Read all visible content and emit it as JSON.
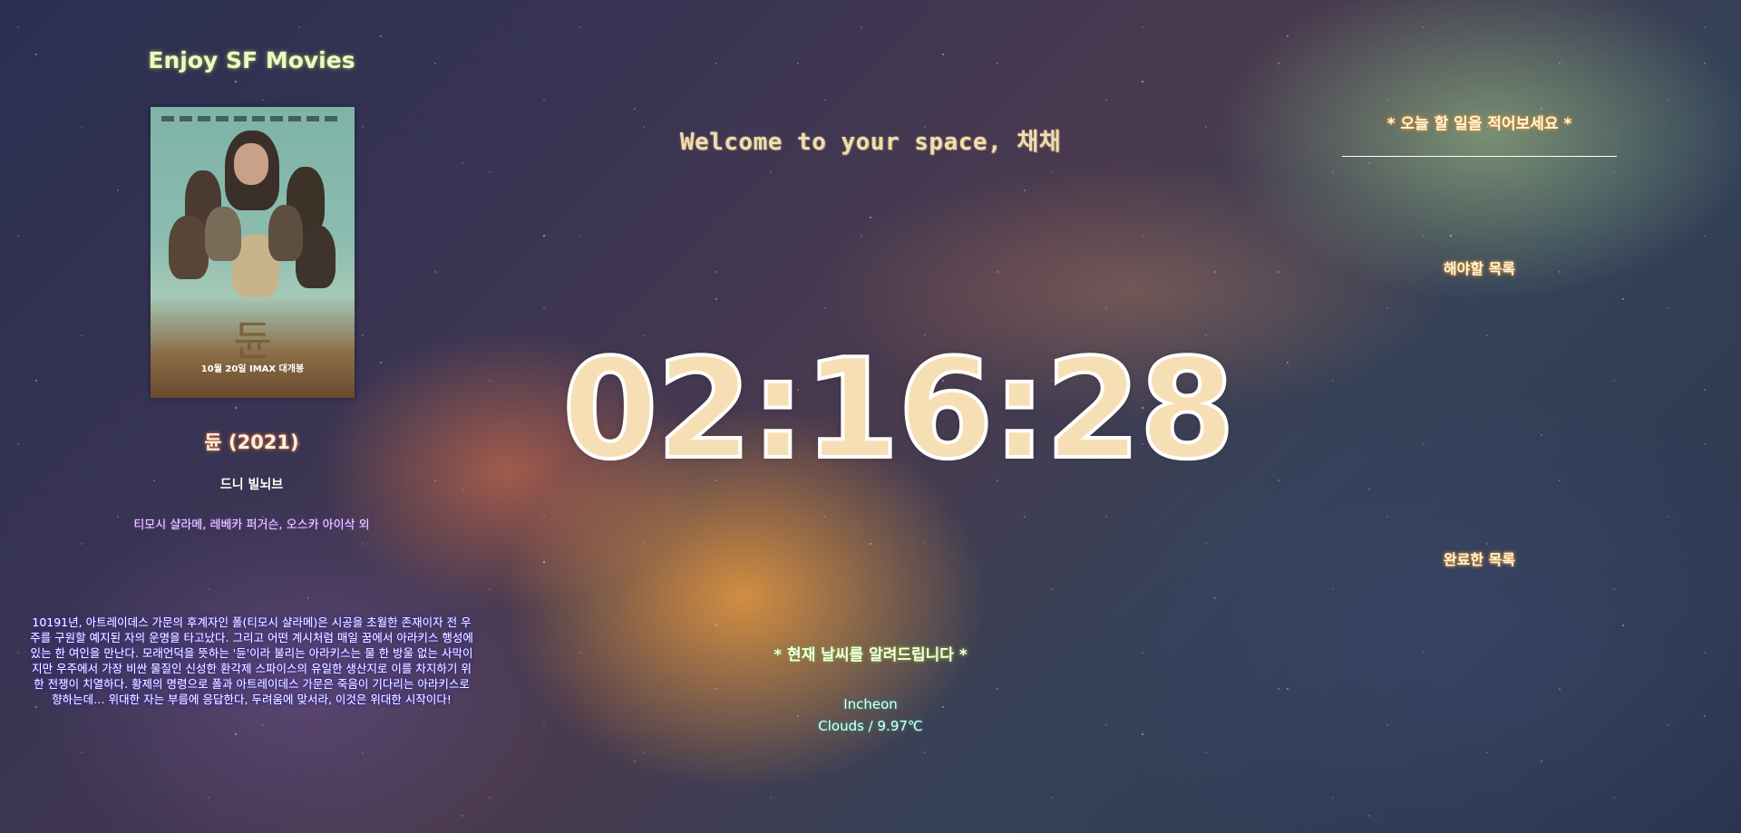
{
  "movie": {
    "header": "Enjoy SF Movies",
    "poster_text": {
      "title_glyph": "듄",
      "release": "10월 20일 IMAX 대개봉"
    },
    "title": "듄 (2021)",
    "director": "드니 빌뇌브",
    "cast": "티모시 샬라메, 레베카 퍼거슨, 오스카 아이삭 외",
    "synopsis": "10191년, 아트레이데스 가문의 후계자인 폴(티모시 샬라메)은 시공을 초월한 존재이자 전 우주를 구원할 예지된 자의 운명을 타고났다. 그리고 어떤 계시처럼 매일 꿈에서 아라키스 행성에 있는 한 여인을 만난다. 모래언덕을 뜻하는 '듄'이라 불리는 아라키스는 물 한 방울 없는 사막이지만 우주에서 가장 비싼 물질인 신성한 환각제 스파이스의 유일한 생산지로 이를 차지하기 위한 전쟁이 치열하다. 황제의 명령으로 폴과 아트레이데스 가문은 죽음이 기다리는 아라키스로 향하는데… 위대한 자는 부름에 응답한다, 두려움에 맞서라, 이것은 위대한 시작이다!"
  },
  "greeting": {
    "text": "Welcome to your space, 채채"
  },
  "clock": {
    "time": "02:16:28"
  },
  "weather": {
    "header": "* 현재 날씨를 알려드립니다 *",
    "city": "Incheon",
    "description": "Clouds / 9.97℃"
  },
  "todo": {
    "placeholder": "* 오늘 할 일을 적어보세요 *",
    "value": "",
    "pending_heading": "해야할 목록",
    "done_heading": "완료한 목록",
    "pending_items": [],
    "done_items": []
  },
  "colors": {
    "header_glow": "#7a8f4a",
    "title_glow": "#c86a3a",
    "synopsis_glow": "#3b2ba8",
    "todo_glow": "#d89030",
    "weather_glow": "#7a9c3a",
    "clock_fill": "#f7dfb5"
  }
}
